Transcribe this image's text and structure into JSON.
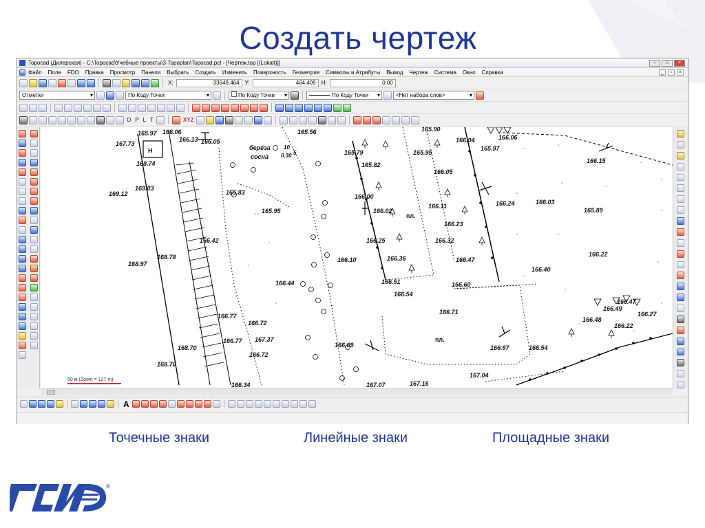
{
  "slide": {
    "title": "Создать чертеж",
    "captions": [
      "Точечные знаки",
      "Линейные знаки",
      "Площадные знаки"
    ],
    "title_color": "#1f3596"
  },
  "window": {
    "title": "Topocad (Дилерская) - C:\\Topocad\\Учебные проекты\\3-Topoplan\\Topocad.pcf - [Чертеж.top [(Lokalt)]]",
    "buttons": [
      "minimize",
      "maximize",
      "close"
    ]
  },
  "menu": {
    "items": [
      "Файл",
      "Поле",
      "FDO",
      "Правка",
      "Просмотр",
      "Панели",
      "Выбрать",
      "Создать",
      "Изменить",
      "Поверхность",
      "Геометрия",
      "Символы и Атрибуты",
      "Вывод",
      "Чертеж",
      "Система",
      "Окно",
      "Справка"
    ]
  },
  "toolbar": {
    "x_label": "X:",
    "x_value": "33649.464",
    "y_label": "Y:",
    "y_value": "464.409",
    "h_label": "H:",
    "h_value": "0.00",
    "layer_select": "Отметки",
    "code_select": "По Коду Точки",
    "code_check_label": "По Коду Точки",
    "line_style_select": "По Коду Точки",
    "wordset_select": "<Нет набора слов>",
    "snap_letters": [
      "O",
      "P",
      "L",
      "T"
    ],
    "xyz_label": "XYZ"
  },
  "map": {
    "scale_text": "50 м (Zoom = 127 m)",
    "labels": [
      "165.97",
      "166.06",
      "166.13",
      "166.05",
      "167.73",
      "Н",
      "168.74",
      "169.03",
      "169.12",
      "165.83",
      "165.95",
      "166.42",
      "168.78",
      "168.97",
      "166.44",
      "166.77",
      "166.72",
      "166.77",
      "167.37",
      "166.72",
      "168.70",
      "168.70",
      "165.56",
      "165.79",
      "165.82",
      "166.00",
      "166.02",
      "166.25",
      "166.36",
      "166.10",
      "166.51",
      "166.54",
      "166.89",
      "167.07",
      "167.16",
      "165.90",
      "165.95",
      "166.05",
      "166.11",
      "166.23",
      "166.32",
      "166.47",
      "166.60",
      "166.71",
      "пл.",
      "пл.",
      "166.97",
      "167.04",
      "166.54",
      "166.04",
      "165.97",
      "166.06",
      "166.15",
      "166.24",
      "166.03",
      "165.89",
      "166.22",
      "166.40",
      "166.47",
      "166.49",
      "166.27",
      "166.48",
      "166.22",
      "166.34"
    ],
    "birch_label": "берёза",
    "pine_label": "сосна",
    "tree_size_top": "10",
    "tree_size_bottom": "0.30",
    "tree_size_right": "5",
    "dense_marks": "\" \" \""
  },
  "logo": {
    "text": "ГСИ",
    "registered": "®"
  }
}
